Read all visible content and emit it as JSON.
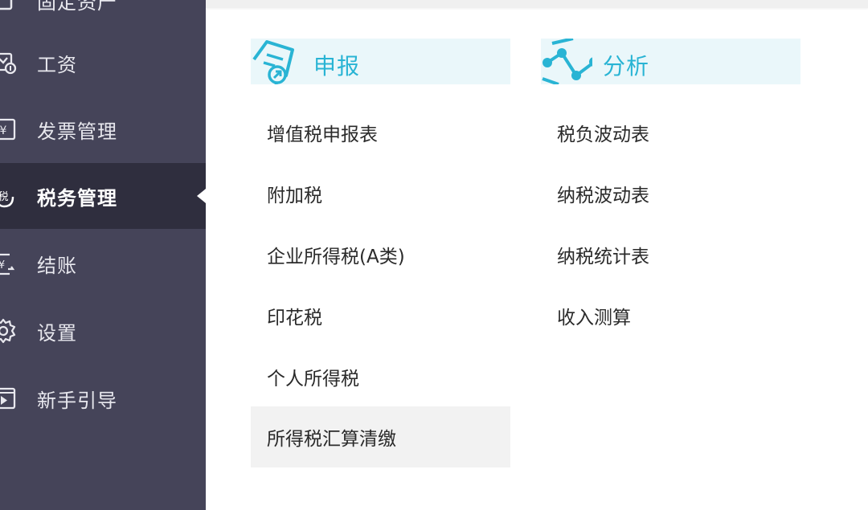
{
  "sidebar": {
    "items": [
      {
        "label": "固定资产",
        "icon": "asset-icon"
      },
      {
        "label": "工资",
        "icon": "salary-icon"
      },
      {
        "label": "发票管理",
        "icon": "invoice-icon"
      },
      {
        "label": "税务管理",
        "icon": "tax-icon",
        "active": true
      },
      {
        "label": "结账",
        "icon": "checkout-icon"
      },
      {
        "label": "设置",
        "icon": "gear-icon"
      },
      {
        "label": "新手引导",
        "icon": "video-guide-icon"
      }
    ],
    "colors": {
      "background": "#454459",
      "active": "#2f2e3e"
    }
  },
  "panel": {
    "left_column": {
      "title": "申报",
      "icon": "declare-document-icon",
      "items": [
        {
          "label": "增值税申报表"
        },
        {
          "label": "附加税"
        },
        {
          "label": "企业所得税(A类)"
        },
        {
          "label": "印花税"
        },
        {
          "label": "个人所得税"
        },
        {
          "label": "所得税汇算清缴",
          "highlighted": true
        }
      ]
    },
    "right_column": {
      "title": "分析",
      "icon": "analysis-chart-icon",
      "items": [
        {
          "label": "税负波动表"
        },
        {
          "label": "纳税波动表"
        },
        {
          "label": "纳税统计表"
        },
        {
          "label": "收入测算"
        }
      ]
    },
    "colors": {
      "accent": "#29b4d4",
      "header_bg": "#eaf7fa",
      "hover_bg": "#f2f2f2"
    }
  }
}
